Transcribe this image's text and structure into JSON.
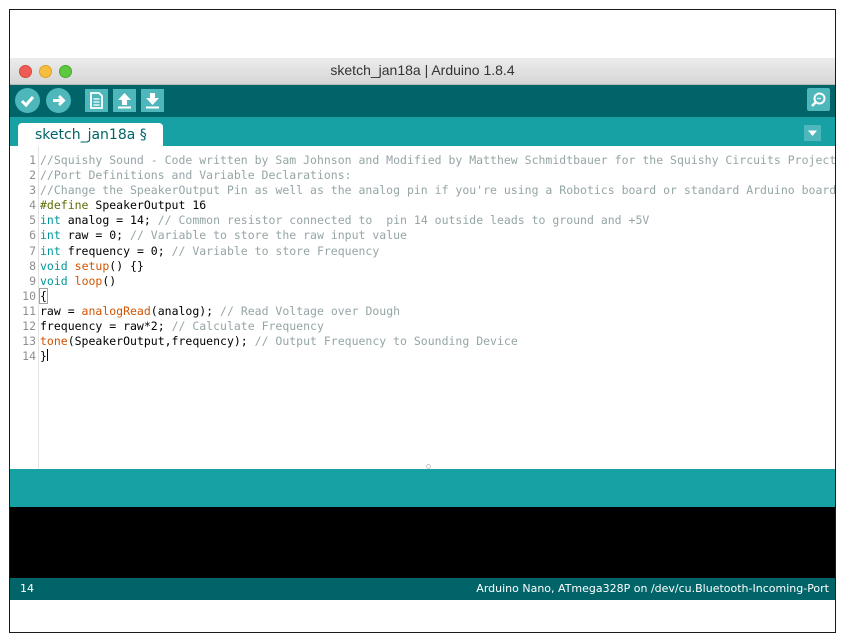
{
  "window": {
    "title": "sketch_jan18a | Arduino 1.8.4"
  },
  "toolbar": {
    "buttons": [
      {
        "name": "verify-button",
        "icon": "checkmark-icon"
      },
      {
        "name": "upload-button",
        "icon": "arrow-right-icon"
      },
      {
        "name": "new-button",
        "icon": "document-icon"
      },
      {
        "name": "open-button",
        "icon": "arrow-up-icon"
      },
      {
        "name": "save-button",
        "icon": "arrow-down-icon"
      }
    ],
    "serial_monitor_icon": "magnifier-icon"
  },
  "tabs": [
    {
      "label": "sketch_jan18a §"
    }
  ],
  "tab_menu_icon": "triangle-down-icon",
  "editor": {
    "lines": [
      {
        "n": "1",
        "tokens": [
          {
            "t": "//Squishy Sound - Code written by Sam Johnson and Modified by Matthew Schmidtbauer for the Squishy Circuits Project",
            "c": "c-cm"
          }
        ]
      },
      {
        "n": "2",
        "tokens": [
          {
            "t": "//Port Definitions and Variable Declarations:",
            "c": "c-cm"
          }
        ]
      },
      {
        "n": "3",
        "tokens": [
          {
            "t": "//Change the SpeakerOutput Pin as well as the analog pin if you're using a Robotics board or standard Arduino board.",
            "c": "c-cm"
          }
        ]
      },
      {
        "n": "4",
        "tokens": [
          {
            "t": "#define",
            "c": "c-pp"
          },
          {
            "t": " SpeakerOutput 16",
            "c": ""
          }
        ]
      },
      {
        "n": "5",
        "tokens": [
          {
            "t": "int",
            "c": "c-kw"
          },
          {
            "t": " analog = 14; ",
            "c": ""
          },
          {
            "t": "// Common resistor connected to  pin 14 outside leads to ground and +5V",
            "c": "c-cm"
          }
        ]
      },
      {
        "n": "6",
        "tokens": [
          {
            "t": "int",
            "c": "c-kw"
          },
          {
            "t": " raw = 0; ",
            "c": ""
          },
          {
            "t": "// Variable to store the raw input value",
            "c": "c-cm"
          }
        ]
      },
      {
        "n": "7",
        "tokens": [
          {
            "t": "int",
            "c": "c-kw"
          },
          {
            "t": " frequency = 0; ",
            "c": ""
          },
          {
            "t": "// Variable to store Frequency",
            "c": "c-cm"
          }
        ]
      },
      {
        "n": "8",
        "tokens": [
          {
            "t": "void",
            "c": "c-kw"
          },
          {
            "t": " ",
            "c": ""
          },
          {
            "t": "setup",
            "c": "c-fn"
          },
          {
            "t": "() {}",
            "c": ""
          }
        ]
      },
      {
        "n": "9",
        "tokens": [
          {
            "t": "void",
            "c": "c-kw"
          },
          {
            "t": " ",
            "c": ""
          },
          {
            "t": "loop",
            "c": "c-fn"
          },
          {
            "t": "()",
            "c": ""
          }
        ]
      },
      {
        "n": "10",
        "tokens": [
          {
            "t": "{",
            "c": "bracebox"
          }
        ]
      },
      {
        "n": "11",
        "tokens": [
          {
            "t": "raw = ",
            "c": ""
          },
          {
            "t": "analogRead",
            "c": "c-fn"
          },
          {
            "t": "(analog); ",
            "c": ""
          },
          {
            "t": "// Read Voltage over Dough",
            "c": "c-cm"
          }
        ]
      },
      {
        "n": "12",
        "tokens": [
          {
            "t": "frequency = raw*2; ",
            "c": ""
          },
          {
            "t": "// Calculate Frequency",
            "c": "c-cm"
          }
        ]
      },
      {
        "n": "13",
        "tokens": [
          {
            "t": "tone",
            "c": "c-fn"
          },
          {
            "t": "(SpeakerOutput,frequency); ",
            "c": ""
          },
          {
            "t": "// Output Frequency to Sounding Device",
            "c": "c-cm"
          }
        ]
      },
      {
        "n": "14",
        "tokens": [
          {
            "t": "}",
            "c": ""
          }
        ]
      }
    ],
    "caret_line": "14"
  },
  "status": {
    "line_number": "14",
    "board": "Arduino Nano, ATmega328P on /dev/cu.Bluetooth-Incoming-Port"
  },
  "colors": {
    "toolbar": "#006468",
    "tabbar": "#17a1a5",
    "button": "#4db7bb",
    "console": "#000000"
  }
}
